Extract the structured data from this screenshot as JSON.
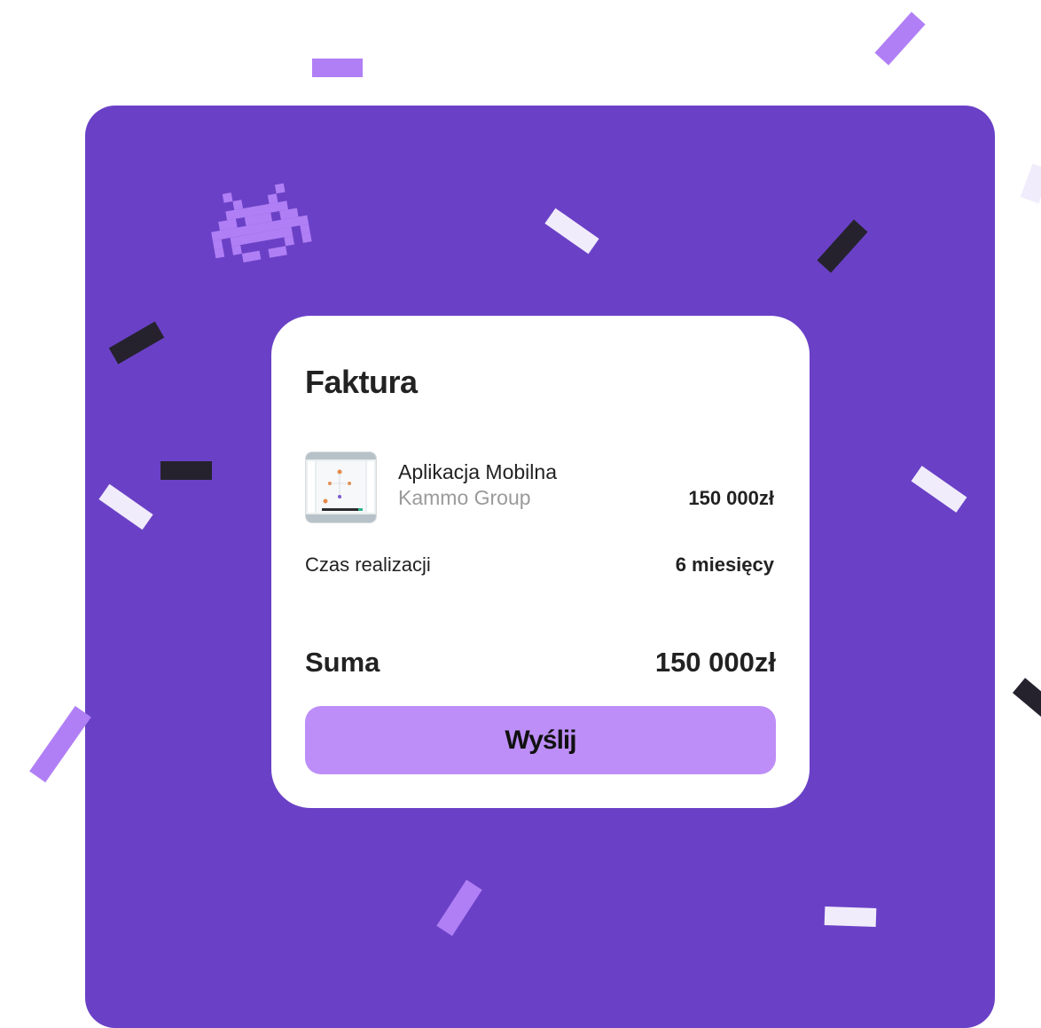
{
  "invoice": {
    "title": "Faktura",
    "item": {
      "name": "Aplikacja Mobilna",
      "company": "Kammo Group",
      "price": "150 000zł",
      "thumbnail": "app-screenshot-thumbnail"
    },
    "delivery_time": {
      "label": "Czas realizacji",
      "value": "6 miesięcy"
    },
    "total": {
      "label": "Suma",
      "value": "150 000zł"
    },
    "send_button": "Wyślij"
  },
  "decorations": {
    "icon": "space-invader-icon"
  },
  "colors": {
    "panel": "#6a41c6",
    "accent": "#bd8ef7",
    "confetti_light": "#f1ecfb",
    "confetti_dark": "#25222e"
  }
}
